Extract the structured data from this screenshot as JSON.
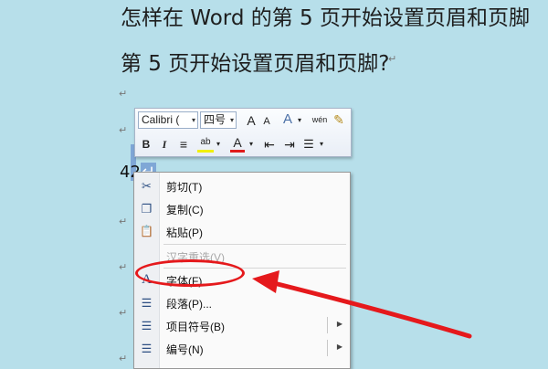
{
  "document": {
    "heading1": "怎样在 Word 的第 5 页开始设置页眉和页脚",
    "heading2": "第 5 页开始设置页眉和页脚?",
    "para_mark": "↵",
    "selected_text": "42",
    "selected_mark": "↵"
  },
  "mini_toolbar": {
    "font_name": "Calibri (",
    "font_size": "四号",
    "grow_font": "A",
    "shrink_font": "A",
    "styles": "A",
    "format_painter": "✎",
    "bold": "B",
    "italic": "I",
    "center": "≡",
    "highlight": "ab",
    "font_color": "A",
    "decrease_indent": "⇤",
    "increase_indent": "⇥",
    "bullets": "☰",
    "wen": "wén",
    "dropdown": "▾"
  },
  "context_menu": {
    "items": [
      {
        "icon": "scissors-icon",
        "glyph": "✂",
        "label": "剪切(T)"
      },
      {
        "icon": "copy-icon",
        "glyph": "❐",
        "label": "复制(C)"
      },
      {
        "icon": "paste-icon",
        "glyph": "📋",
        "label": "粘贴(P)"
      },
      {
        "icon": "none",
        "glyph": "",
        "label": "汉字重选(V)",
        "disabled": true
      },
      {
        "icon": "font-icon",
        "glyph": "A",
        "label": "字体(F)..."
      },
      {
        "icon": "paragraph-icon",
        "glyph": "☰",
        "label": "段落(P)..."
      },
      {
        "icon": "bullets-icon",
        "glyph": "☰",
        "label": "项目符号(B)",
        "submenu": "▶"
      },
      {
        "icon": "numbering-icon",
        "glyph": "☰",
        "label": "编号(N)",
        "submenu": "▶"
      }
    ]
  },
  "colors": {
    "background": "#b7dfea",
    "annotation": "#e5191c",
    "selection": "#7fa7d6"
  }
}
